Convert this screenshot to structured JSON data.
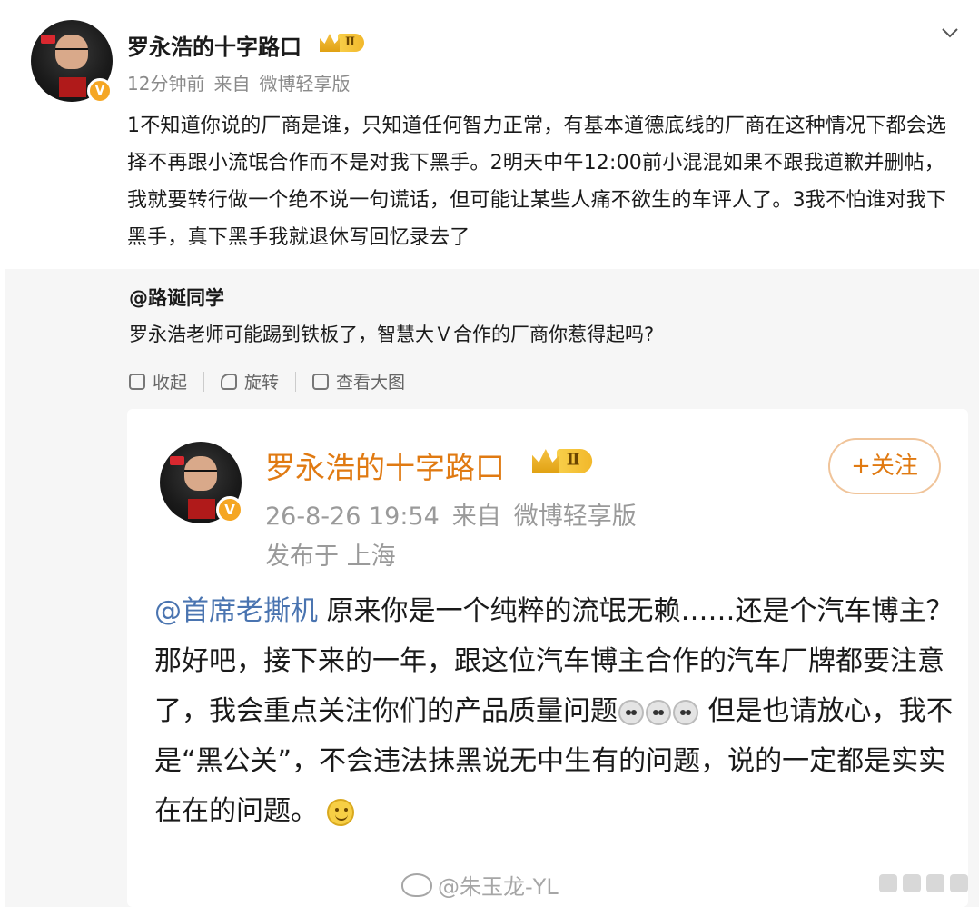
{
  "post": {
    "author": "罗永浩的十字路口",
    "level_badge": "Ⅱ",
    "time": "12分钟前",
    "source_prefix": "来自",
    "source": "微博轻享版",
    "verified_mark": "V",
    "content": "1不知道你说的厂商是谁，只知道任何智力正常，有基本道德底线的厂商在这种情况下都会选择不再跟小流氓合作而不是对我下黑手。2明天中午12:00前小混混如果不跟我道歉并删帖，我就要转行做一个绝不说一句谎话，但可能让某些人痛不欲生的车评人了。3我不怕谁对我下黑手，真下黑手我就退休写回忆录去了"
  },
  "repost": {
    "user": "@路诞同学",
    "text": "罗永浩老师可能踢到铁板了，智慧大Ｖ合作的厂商你惹得起吗?",
    "tools": {
      "collapse": "收起",
      "rotate": "旋转",
      "view_large": "查看大图"
    }
  },
  "card": {
    "author": "罗永浩的十字路口",
    "level_badge": "Ⅱ",
    "follow": "+关注",
    "datetime": "26-8-26 19:54",
    "source_prefix": "来自",
    "source": "微博轻享版",
    "location": "发布于 上海",
    "mention": "@首席老撕机",
    "body_1": " 原来你是一个纯粹的流氓无赖……还是个汽车博主？那好吧，接下来的一年，跟这位汽车博主合作的汽车厂牌都要注意了，我会重点关注你们的产品质量问题",
    "body_2": " 但是也请放心，我不是“黑公关”，不会违法抹黑说无中生有的问题，说的一定都是实实在在的问题。"
  },
  "watermark": "@朱玉龙-YL",
  "colors": {
    "accent_orange": "#e07a12",
    "mention_blue": "#4a74b0",
    "badge_gold": "#f5a623"
  }
}
